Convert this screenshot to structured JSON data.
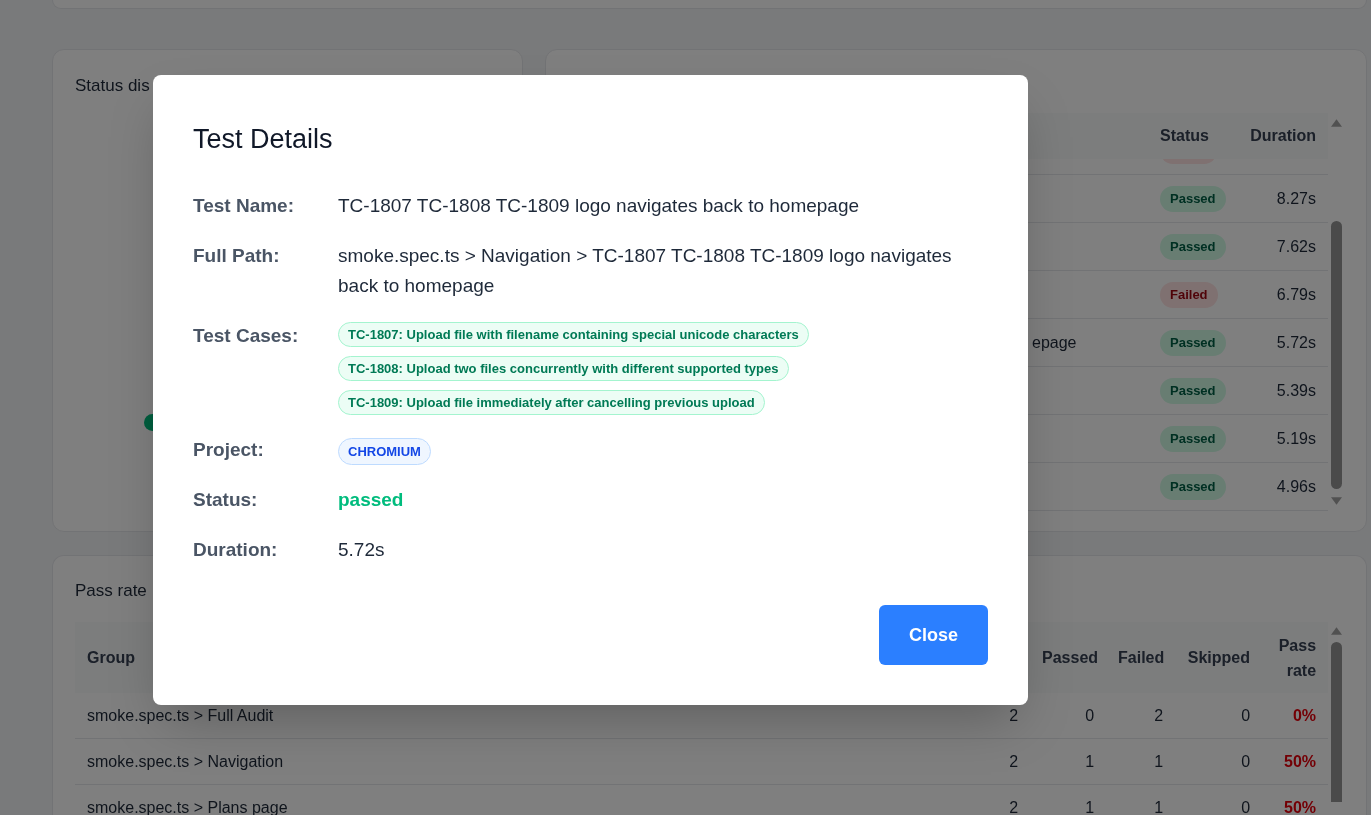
{
  "status_card": {
    "title": "Status dis"
  },
  "results_table": {
    "columns": {
      "status": "Status",
      "duration": "Duration"
    },
    "partial_top_row": {
      "failed": true
    },
    "rows": [
      {
        "status": {
          "label": "Passed",
          "failed": false
        },
        "duration": "8.27s"
      },
      {
        "status": {
          "label": "Passed",
          "failed": false
        },
        "duration": "7.62s"
      },
      {
        "status": {
          "label": "Failed",
          "failed": true
        },
        "duration": "6.79s"
      },
      {
        "name": "epage",
        "status": {
          "label": "Passed",
          "failed": false
        },
        "duration": "5.72s"
      },
      {
        "status": {
          "label": "Passed",
          "failed": false
        },
        "duration": "5.39s"
      },
      {
        "status": {
          "label": "Passed",
          "failed": false
        },
        "duration": "5.19s"
      },
      {
        "status": {
          "label": "Passed",
          "failed": false
        },
        "duration": "4.96s"
      }
    ]
  },
  "pass_rate_card": {
    "title": "Pass rate",
    "columns": {
      "group": "Group",
      "passed": "Passed",
      "failed": "Failed",
      "skipped": "Skipped",
      "pass_rate": "Pass rate"
    },
    "rows": [
      {
        "group": "smoke.spec.ts > Full Audit",
        "column_2": "2",
        "passed": "0",
        "failed": "2",
        "skipped": "0",
        "pass_rate": "0%",
        "failing": true
      },
      {
        "group": "smoke.spec.ts > Navigation",
        "column_2": "2",
        "passed": "1",
        "failed": "1",
        "skipped": "0",
        "pass_rate": "50%",
        "failing": true
      },
      {
        "group": "smoke.spec.ts > Plans page",
        "column_2": "2",
        "passed": "1",
        "failed": "1",
        "skipped": "0",
        "pass_rate": "50%",
        "failing": true
      }
    ]
  },
  "modal": {
    "title": "Test Details",
    "fields": [
      {
        "kind": "text",
        "label": "Test Name:",
        "value": "TC-1807 TC-1808 TC-1809 logo navigates back to homepage"
      },
      {
        "kind": "text",
        "label": "Full Path:",
        "value": "smoke.spec.ts > Navigation > TC-1807 TC-1808 TC-1809 logo navigates back to homepage"
      },
      {
        "kind": "chips",
        "label": "Test Cases:",
        "chips": [
          "TC-1807: Upload file with filename containing special unicode characters",
          "TC-1808: Upload two files concurrently with different supported types",
          "TC-1809: Upload file immediately after cancelling previous upload"
        ]
      },
      {
        "kind": "tag",
        "label": "Project:",
        "value": "CHROMIUM"
      },
      {
        "kind": "status",
        "label": "Status:",
        "value": "passed",
        "success": true
      },
      {
        "kind": "text",
        "label": "Duration:",
        "value": "5.72s"
      }
    ],
    "close_button": "Close"
  }
}
